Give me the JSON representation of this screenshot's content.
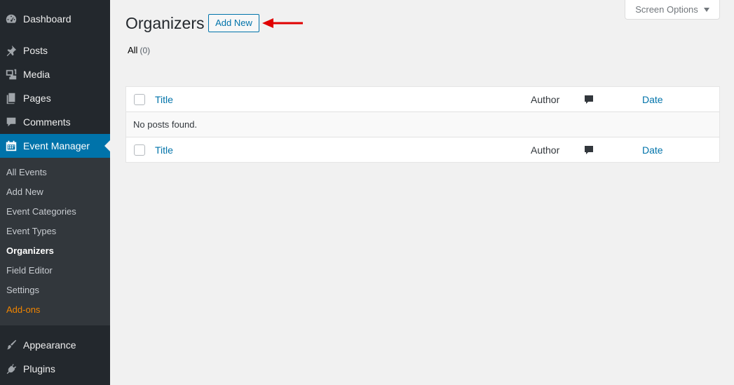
{
  "sidebar": {
    "dashboard": "Dashboard",
    "posts": "Posts",
    "media": "Media",
    "pages": "Pages",
    "comments": "Comments",
    "event_manager": "Event Manager",
    "appearance": "Appearance",
    "plugins": "Plugins",
    "submenu": {
      "all_events": "All Events",
      "add_new": "Add New",
      "event_categories": "Event Categories",
      "event_types": "Event Types",
      "organizers": "Organizers",
      "field_editor": "Field Editor",
      "settings": "Settings",
      "addons": "Add-ons"
    }
  },
  "header": {
    "title": "Organizers",
    "add_new": "Add New",
    "screen_options": "Screen Options"
  },
  "filters": {
    "all_label": "All",
    "all_count": "(0)"
  },
  "table": {
    "columns": {
      "title": "Title",
      "author": "Author",
      "date": "Date"
    },
    "empty_message": "No posts found."
  },
  "colors": {
    "sidebar_bg": "#23282d",
    "submenu_bg": "#32373c",
    "accent": "#0073aa",
    "addons": "#f18500",
    "annotation_arrow": "#e00000"
  }
}
